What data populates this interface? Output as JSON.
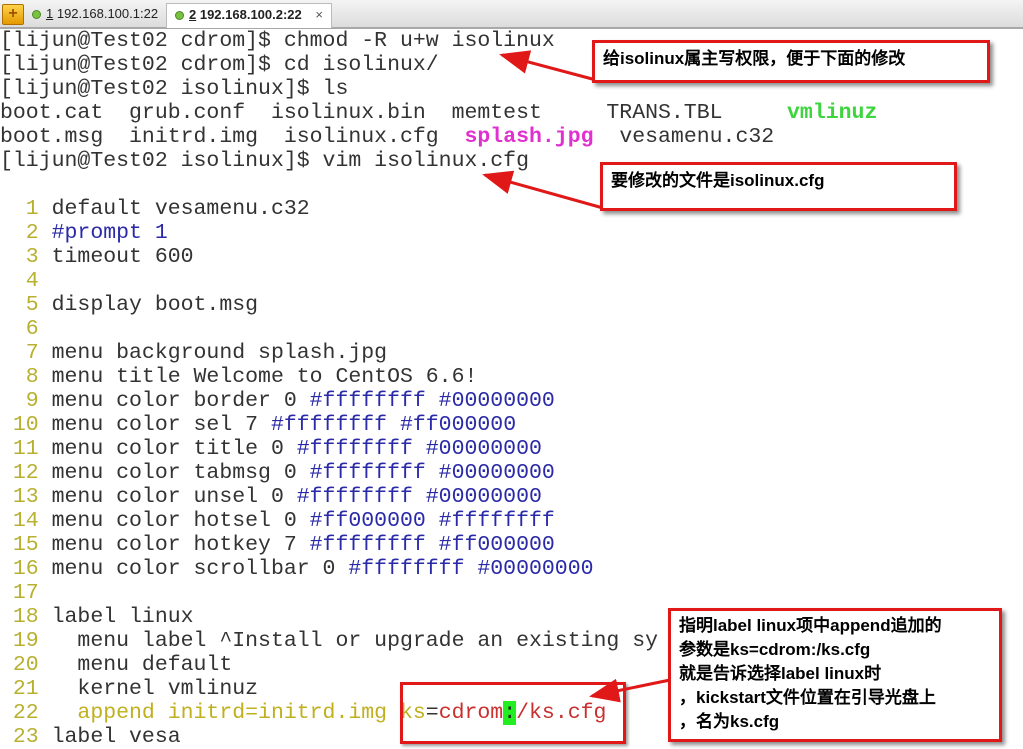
{
  "tabbar": {
    "new_tab_icon": "plus-icon",
    "tabs": [
      {
        "num": "1",
        "label": " 192.168.100.1:22",
        "active": false
      },
      {
        "num": "2",
        "label": " 192.168.100.2:22",
        "active": true
      }
    ],
    "close": "×"
  },
  "colors": {
    "accent": "#e01818",
    "line_number": "#b8b030",
    "hex": "#2a2aa8",
    "exec": "#3dd43d",
    "image": "#e030d0"
  },
  "terminal": [
    [
      {
        "t": "[lijun@Test02 cdrom]$ chmod -R u+w isolinux"
      }
    ],
    [
      {
        "t": "[lijun@Test02 cdrom]$ cd isolinux/"
      }
    ],
    [
      {
        "t": "[lijun@Test02 isolinux]$ ls"
      }
    ],
    [
      {
        "t": "boot.cat  grub.conf  isolinux.bin  memtest     TRANS.TBL     "
      },
      {
        "t": "vmlinuz",
        "c": "green"
      }
    ],
    [
      {
        "t": "boot.msg  initrd.img  isolinux.cfg  "
      },
      {
        "t": "splash.jpg",
        "c": "mag"
      },
      {
        "t": "  vesamenu.c32"
      }
    ],
    [
      {
        "t": "[lijun@Test02 isolinux]$ vim isolinux.cfg"
      }
    ],
    [
      {
        "t": ""
      }
    ],
    [
      {
        "t": "  1 ",
        "c": "ln"
      },
      {
        "t": "default vesamenu.c32"
      }
    ],
    [
      {
        "t": "  2 ",
        "c": "ln"
      },
      {
        "t": "#prompt 1",
        "c": "cmt"
      }
    ],
    [
      {
        "t": "  3 ",
        "c": "ln"
      },
      {
        "t": "timeout 600"
      }
    ],
    [
      {
        "t": "  4 ",
        "c": "ln"
      }
    ],
    [
      {
        "t": "  5 ",
        "c": "ln"
      },
      {
        "t": "display boot.msg"
      }
    ],
    [
      {
        "t": "  6 ",
        "c": "ln"
      }
    ],
    [
      {
        "t": "  7 ",
        "c": "ln"
      },
      {
        "t": "menu background splash.jpg"
      }
    ],
    [
      {
        "t": "  8 ",
        "c": "ln"
      },
      {
        "t": "menu title Welcome to CentOS 6.6!"
      }
    ],
    [
      {
        "t": "  9 ",
        "c": "ln"
      },
      {
        "t": "menu color border 0 "
      },
      {
        "t": "#ffffffff #00000000",
        "c": "hex"
      }
    ],
    [
      {
        "t": " 10 ",
        "c": "ln"
      },
      {
        "t": "menu color sel 7 "
      },
      {
        "t": "#ffffffff #ff000000",
        "c": "hex"
      }
    ],
    [
      {
        "t": " 11 ",
        "c": "ln"
      },
      {
        "t": "menu color title 0 "
      },
      {
        "t": "#ffffffff #00000000",
        "c": "hex"
      }
    ],
    [
      {
        "t": " 12 ",
        "c": "ln"
      },
      {
        "t": "menu color tabmsg 0 "
      },
      {
        "t": "#ffffffff #00000000",
        "c": "hex"
      }
    ],
    [
      {
        "t": " 13 ",
        "c": "ln"
      },
      {
        "t": "menu color unsel 0 "
      },
      {
        "t": "#ffffffff #00000000",
        "c": "hex"
      }
    ],
    [
      {
        "t": " 14 ",
        "c": "ln"
      },
      {
        "t": "menu color hotsel 0 "
      },
      {
        "t": "#ff000000 #ffffffff",
        "c": "hex"
      }
    ],
    [
      {
        "t": " 15 ",
        "c": "ln"
      },
      {
        "t": "menu color hotkey 7 "
      },
      {
        "t": "#ffffffff #ff000000",
        "c": "hex"
      }
    ],
    [
      {
        "t": " 16 ",
        "c": "ln"
      },
      {
        "t": "menu color scrollbar 0 "
      },
      {
        "t": "#ffffffff #00000000",
        "c": "hex"
      }
    ],
    [
      {
        "t": " 17 ",
        "c": "ln"
      }
    ],
    [
      {
        "t": " 18 ",
        "c": "ln"
      },
      {
        "t": "label linux"
      }
    ],
    [
      {
        "t": " 19 ",
        "c": "ln"
      },
      {
        "t": "  menu label ^Install or upgrade an existing sy"
      }
    ],
    [
      {
        "t": " 20 ",
        "c": "ln"
      },
      {
        "t": "  menu default"
      }
    ],
    [
      {
        "t": " 21 ",
        "c": "ln"
      },
      {
        "t": "  kernel vmlinuz"
      }
    ],
    [
      {
        "t": " 22 ",
        "c": "ln"
      },
      {
        "t": "  append initrd=initrd.img ks",
        "c": "olive"
      },
      {
        "t": "="
      },
      {
        "t": "cdrom",
        "c": "red"
      },
      {
        "t": ":",
        "c": "cur"
      },
      {
        "t": "/ks.cfg",
        "c": "red"
      }
    ],
    [
      {
        "t": " 23 ",
        "c": "ln"
      },
      {
        "t": "label vesa"
      }
    ]
  ],
  "callouts": {
    "chmod": "给isolinux属主写权限，便于下面的修改",
    "vim": "要修改的文件是isolinux.cfg",
    "append": [
      "指明label linux项中append追加的",
      "参数是ks=cdrom:/ks.cfg",
      "就是告诉选择label linux时",
      "，kickstart文件位置在引导光盘上",
      "，名为ks.cfg"
    ]
  }
}
